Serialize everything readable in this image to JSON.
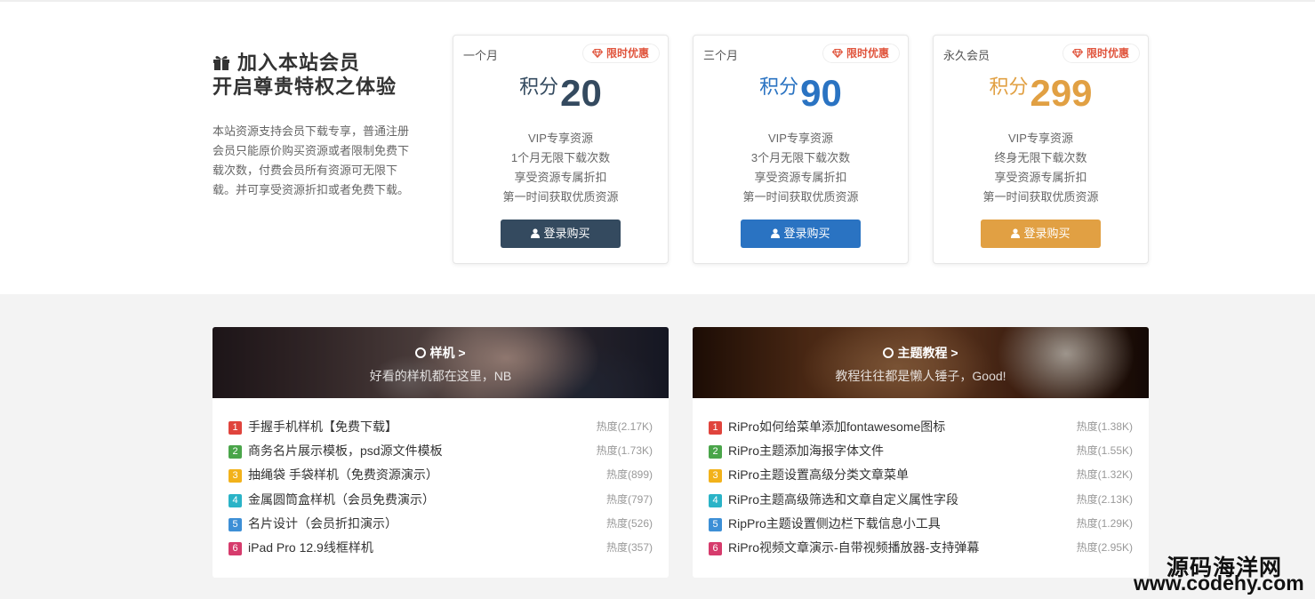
{
  "vip": {
    "title_line1": "加入本站会员",
    "title_line2": "开启尊贵特权之体验",
    "description": "本站资源支持会员下载专享，普通注册会员只能原价购买资源或者限制免费下载次数，付费会员所有资源可无限下载。并可享受资源折扣或者免费下载。",
    "plans": [
      {
        "name": "一个月",
        "badge": "限时优惠",
        "unit": "积分",
        "price": "20",
        "features": [
          "VIP专享资源",
          "1个月无限下载次数",
          "享受资源专属折扣",
          "第一时间获取优质资源"
        ],
        "button": "登录购买",
        "color": "#344a5f"
      },
      {
        "name": "三个月",
        "badge": "限时优惠",
        "unit": "积分",
        "price": "90",
        "features": [
          "VIP专享资源",
          "3个月无限下载次数",
          "享受资源专属折扣",
          "第一时间获取优质资源"
        ],
        "button": "登录购买",
        "color": "#2a73c2"
      },
      {
        "name": "永久会员",
        "badge": "限时优惠",
        "unit": "积分",
        "price": "299",
        "features": [
          "VIP专享资源",
          "终身无限下载次数",
          "享受资源专属折扣",
          "第一时间获取优质资源"
        ],
        "button": "登录购买",
        "color": "#e1a043"
      }
    ]
  },
  "categories": [
    {
      "title": "样机 >",
      "subtitle": "好看的样机都在这里，NB",
      "items": [
        {
          "num": "1",
          "title": "手握手机样机【免费下载】",
          "heat": "热度(2.17K)"
        },
        {
          "num": "2",
          "title": "商务名片展示模板，psd源文件模板",
          "heat": "热度(1.73K)"
        },
        {
          "num": "3",
          "title": "抽绳袋 手袋样机（免费资源演示）",
          "heat": "热度(899)"
        },
        {
          "num": "4",
          "title": "金属圆筒盒样机（会员免费演示）",
          "heat": "热度(797)"
        },
        {
          "num": "5",
          "title": "名片设计（会员折扣演示）",
          "heat": "热度(526)"
        },
        {
          "num": "6",
          "title": "iPad Pro 12.9线框样机",
          "heat": "热度(357)"
        }
      ]
    },
    {
      "title": "主题教程 >",
      "subtitle": "教程往往都是懒人锤子，Good!",
      "items": [
        {
          "num": "1",
          "title": "RiPro如何给菜单添加fontawesome图标",
          "heat": "热度(1.38K)"
        },
        {
          "num": "2",
          "title": "RiPro主题添加海报字体文件",
          "heat": "热度(1.55K)"
        },
        {
          "num": "3",
          "title": "RiPro主题设置高级分类文章菜单",
          "heat": "热度(1.32K)"
        },
        {
          "num": "4",
          "title": "RiPro主题高级筛选和文章自定义属性字段",
          "heat": "热度(2.13K)"
        },
        {
          "num": "5",
          "title": "RipPro主题设置侧边栏下载信息小工具",
          "heat": "热度(1.29K)"
        },
        {
          "num": "6",
          "title": "RiPro视频文章演示-自带视频播放器-支持弹幕",
          "heat": "热度(2.95K)"
        }
      ]
    }
  ],
  "rank_colors": [
    "#e0443d",
    "#4aa54a",
    "#f2b21b",
    "#2ab3c7",
    "#3d8fd6",
    "#d63b6c"
  ],
  "watermark": {
    "line1": "源码海洋网",
    "line2": "www.codehy.com"
  }
}
